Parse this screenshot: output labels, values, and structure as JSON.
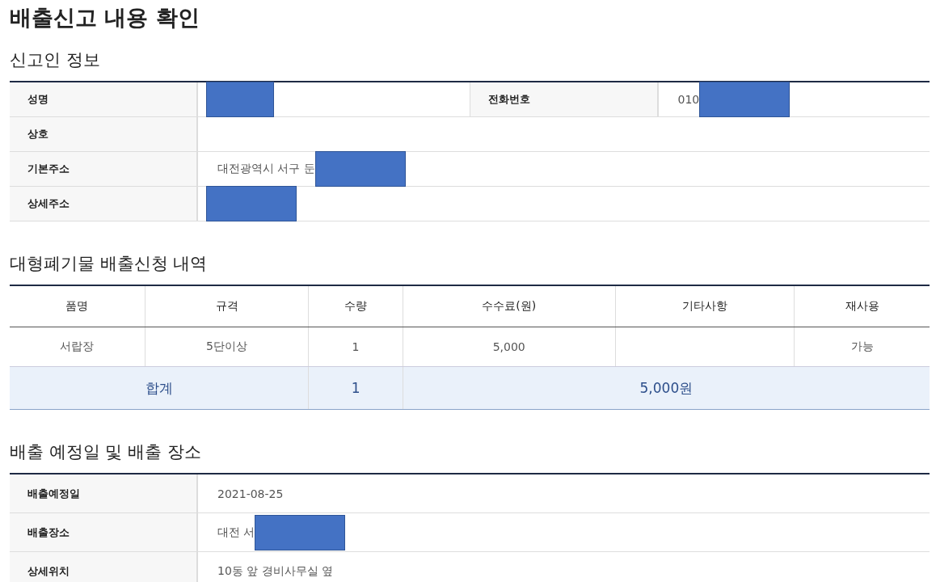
{
  "page_title": "배출신고 내용 확인",
  "applicant": {
    "title": "신고인 정보",
    "rows": [
      {
        "fields": [
          {
            "label": "성명",
            "redacted": true
          },
          {
            "label": "전화번호",
            "value": "010",
            "redacted": true
          }
        ]
      },
      {
        "fields": [
          {
            "label": "상호",
            "redacted": false
          }
        ]
      },
      {
        "fields": [
          {
            "label": "기본주소",
            "value": "대전광역시 서구 둔",
            "redacted": true
          }
        ]
      },
      {
        "fields": [
          {
            "label": "상세주소",
            "redacted": true
          }
        ]
      }
    ]
  },
  "items": {
    "title": "대형폐기물 배출신청 내역",
    "columns": [
      "품명",
      "규격",
      "수량",
      "수수료(원)",
      "기타사항",
      "재사용"
    ],
    "rows": [
      [
        "서랍장",
        "5단이상",
        "1",
        "5,000",
        "",
        "가능"
      ]
    ],
    "total": {
      "label": "합계",
      "quantity": "1",
      "fee": "5,000원"
    }
  },
  "schedule": {
    "title": "배출 예정일 및 배출 장소",
    "rows": [
      {
        "fields": [
          {
            "label": "배출예정일",
            "value": "2021-08-25",
            "redacted": false
          }
        ]
      },
      {
        "fields": [
          {
            "label": "배출장소",
            "value": "대전 서",
            "redacted": true
          }
        ]
      },
      {
        "fields": [
          {
            "label": "상세위치",
            "value": "10동 앞 경비사무실 옆",
            "redacted": false
          }
        ]
      }
    ]
  }
}
